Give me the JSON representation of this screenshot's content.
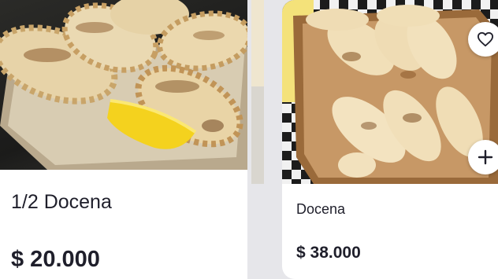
{
  "products": [
    {
      "title": "1/2 Docena",
      "price": "$ 20.000",
      "image": "empanadas-half-dozen-photo"
    },
    {
      "title": "Docena",
      "price": "$ 38.000",
      "image": "empanadas-dozen-photo"
    }
  ],
  "icons": {
    "favorite": "heart-icon",
    "add": "plus-icon"
  },
  "colors": {
    "text": "#1f1f2b",
    "background": "#e6e6ea",
    "card": "#ffffff"
  }
}
